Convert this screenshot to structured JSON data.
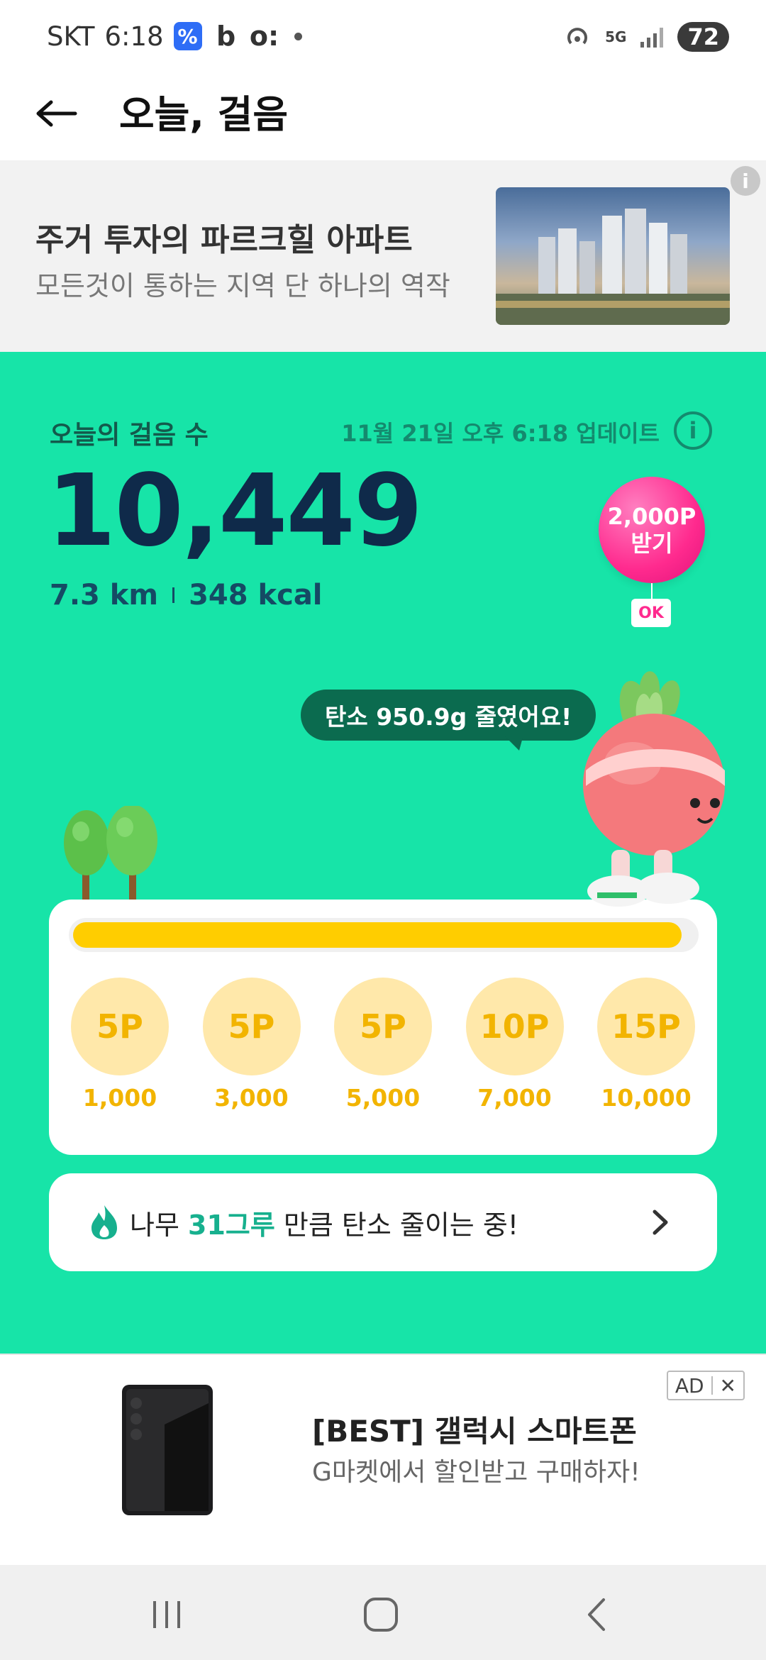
{
  "status_bar": {
    "carrier": "SKT",
    "time": "6:18",
    "battery": "72",
    "network": "5G"
  },
  "header": {
    "title": "오늘, 걸음"
  },
  "top_ad": {
    "title": "주거 투자의 파르크힐 아파트",
    "subtitle": "모든것이 통하는 지역 단 하나의 역작",
    "info_label": "i"
  },
  "steps": {
    "label": "오늘의 걸음 수",
    "updated": "11월 21일 오후 6:18 업데이트",
    "count": "10,449",
    "distance": "7.3 km",
    "calories": "348 kcal",
    "progress_fraction": 0.98
  },
  "balloon": {
    "line1": "2,000P",
    "line2": "받기",
    "brand": "OK"
  },
  "carbon_bubble": "탄소 950.9g 줄였어요!",
  "rewards": [
    {
      "points": "5P",
      "steps": "1,000"
    },
    {
      "points": "5P",
      "steps": "3,000"
    },
    {
      "points": "5P",
      "steps": "5,000"
    },
    {
      "points": "10P",
      "steps": "7,000"
    },
    {
      "points": "15P",
      "steps": "10,000"
    }
  ],
  "tree_card": {
    "prefix": "나무 ",
    "highlight": "31그루",
    "suffix": " 만큼 탄소 줄이는 중!"
  },
  "bottom_ad": {
    "title": "[BEST] 갤럭시 스마트폰",
    "subtitle": "G마켓에서 할인받고 구매하자!",
    "badge": "AD",
    "close": "✕"
  },
  "colors": {
    "green_bg": "#17e4a8",
    "progress": "#ffcd00",
    "reward_bg": "#ffe8aa",
    "reward_text": "#f2b400",
    "highlight": "#17b08e",
    "balloon": "#ff2a8e"
  }
}
